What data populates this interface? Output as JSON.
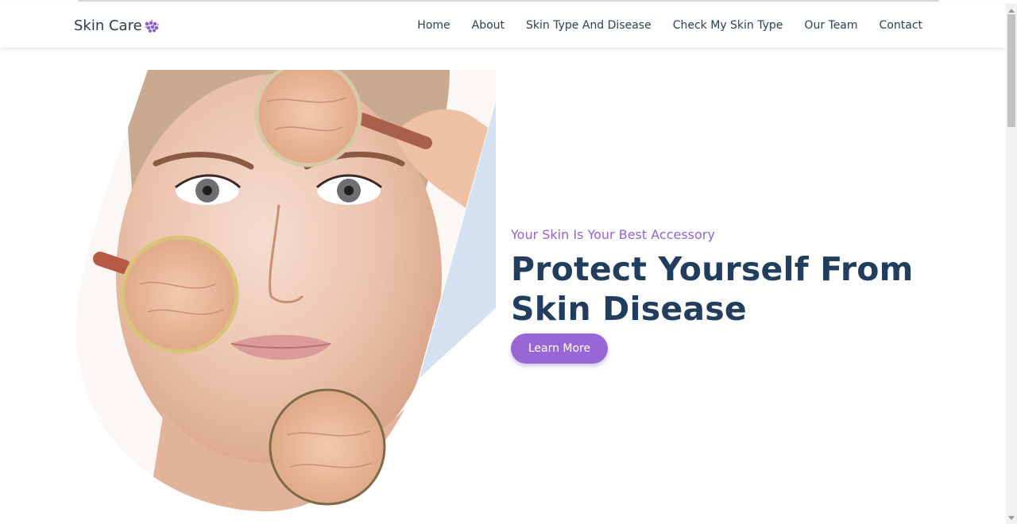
{
  "navbar": {
    "brand": "Skin Care",
    "brand_icon": "dots-cluster-icon",
    "links": [
      "Home",
      "About",
      "Skin Type And Disease",
      "Check My Skin Type",
      "Our Team",
      "Contact"
    ]
  },
  "hero": {
    "image": "face-with-magnifying-glasses-illustration",
    "tagline": "Your Skin Is Your Best Accessory",
    "headline_line1": "Protect Yourself From",
    "headline_line2": "Skin Disease",
    "cta_label": "Learn More"
  },
  "colors": {
    "accent": "#9966d6",
    "tagline": "#9561d3",
    "headline": "#213e5e",
    "nav_text": "#2b3f58"
  }
}
